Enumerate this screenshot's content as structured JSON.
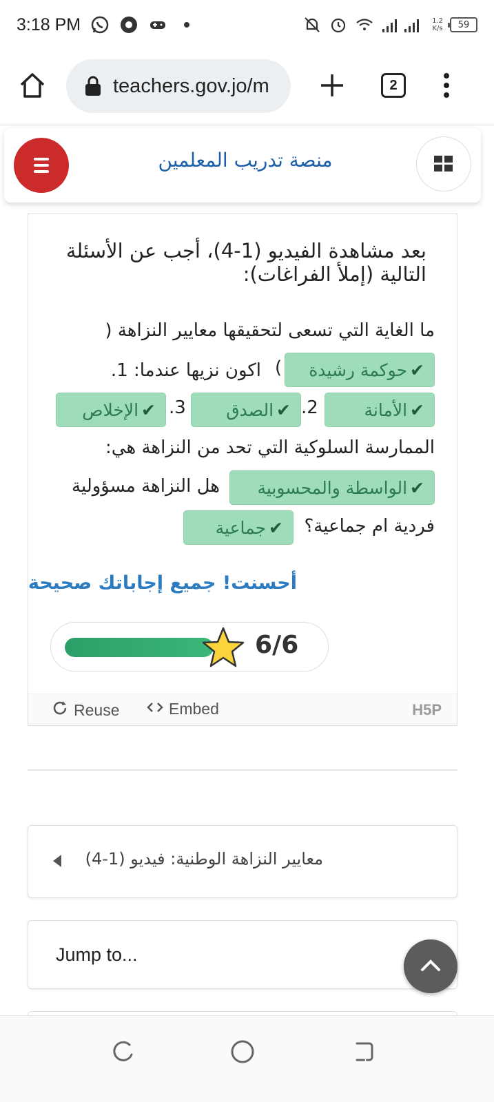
{
  "status_bar": {
    "time": "3:18 PM",
    "net_speed_value": "1.2",
    "net_speed_unit": "K/s",
    "battery": "59"
  },
  "browser": {
    "url": "teachers.gov.jo/m",
    "tab_count": "2"
  },
  "site": {
    "title": "منصة تدريب المعلمين"
  },
  "h5p": {
    "intro": "بعد مشاهدة الفيديو (1-4)، أجب عن الأسئلة التالية (إملأ الفراغات):",
    "line1": "ما الغاية التي تسعى لتحقيقها معايير النزاهة (",
    "line2_close": ")",
    "line2_text": "اكون نزيها عندما: 1.",
    "num2": "2.",
    "num3": "3.",
    "line4": "الممارسة السلوكية التي تحد من النزاهة هي:",
    "line5": "هل النزاهة مسؤولية",
    "line6": "فردية ام جماعية؟",
    "answers": {
      "a1": "حوكمة رشيدة",
      "a2": "الأمانة",
      "a3": "الصدق",
      "a4": "الإخلاص",
      "a5": "الواسطة والمحسوبية",
      "a6": "جماعية"
    },
    "check_mark": "✔",
    "feedback": "أحسنت! جميع إجاباتك صحيحة",
    "score": "6/6",
    "score_progress": 1.0,
    "reuse_label": "Reuse",
    "embed_label": "Embed",
    "logo": "H5P"
  },
  "navigation": {
    "prev_activity": "معايير النزاهة الوطنية: فيديو (1-4)",
    "jump_placeholder": "Jump to..."
  },
  "colors": {
    "menu_button": "#cc2b2b",
    "title_blue": "#1d5ea8",
    "answer_bg": "#9fdcb9",
    "answer_text": "#2b7a50",
    "feedback_blue": "#2a7bc0",
    "progress_green": "#2c9e68"
  }
}
